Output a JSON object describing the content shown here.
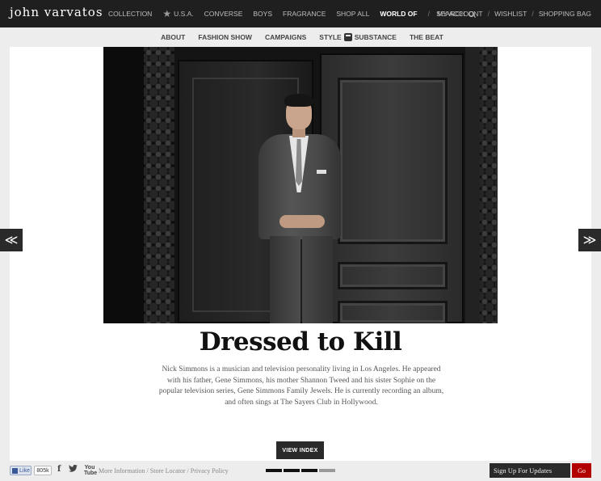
{
  "brand": {
    "logo": "john varvatos"
  },
  "main_nav": {
    "items": [
      "COLLECTION",
      "U.S.A.",
      "CONVERSE",
      "BOYS",
      "FRAGRANCE",
      "SHOP ALL",
      "WORLD OF"
    ],
    "search_label": "SEARCH"
  },
  "account_nav": [
    "MY ACCOUNT",
    "WISHLIST",
    "SHOPPING BAG"
  ],
  "sub_nav": [
    "ABOUT",
    "FASHION SHOW",
    "CAMPAIGNS",
    "STYLE",
    "SUBSTANCE",
    "THE BEAT"
  ],
  "article": {
    "title": "Dressed to Kill",
    "body": "Nick Simmons is a musician and television personality living in Los Angeles. He appeared with his father, Gene Simmons, his mother Shannon Tweed and his sister Sophie on the popular television series, Gene Simmons Family Jewels. He is currently recording an album, and often sings at The Sayers Club in Hollywood.",
    "view_index": "VIEW INDEX"
  },
  "arrows": {
    "prev": "≪",
    "next": "≫"
  },
  "footer": {
    "like_label": "Like",
    "like_count": "805k",
    "facebook": "f",
    "youtube": "You Tube",
    "links": [
      "More Information",
      "Store Locator",
      "Privacy Policy"
    ],
    "pager_total": 4,
    "pager_active": 3,
    "signup_placeholder": "Sign Up For Updates",
    "go_label": "Go"
  },
  "colors": {
    "nav_bg": "#1f1f1f",
    "accent_red": "#b20000"
  }
}
